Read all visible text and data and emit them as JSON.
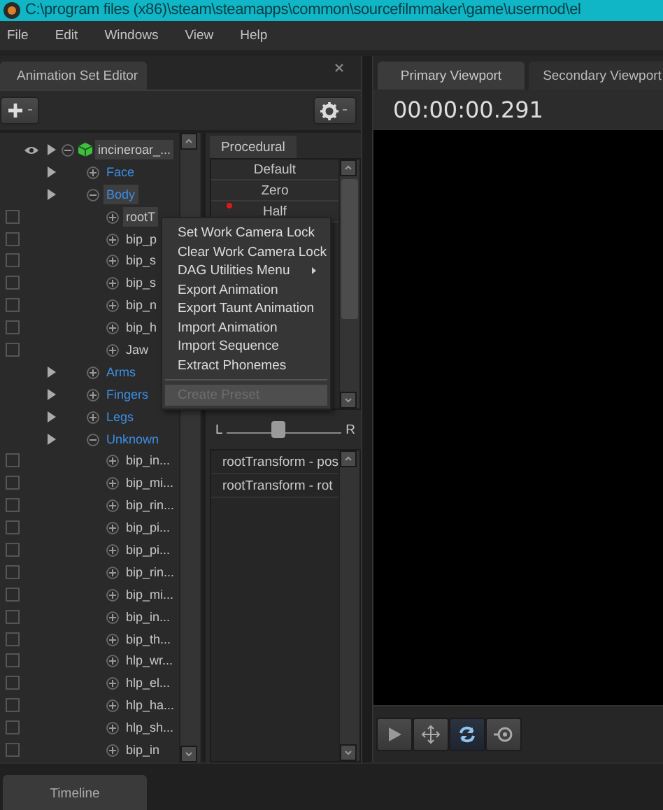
{
  "window": {
    "title": "C:\\program files (x86)\\steam\\steamapps\\common\\sourcefilmmaker\\game\\usermod\\el"
  },
  "menu_bar": [
    "File",
    "Edit",
    "Windows",
    "View",
    "Help"
  ],
  "animation_set_editor": {
    "tab": "Animation Set Editor",
    "tree": [
      {
        "label": "incineroar_...",
        "kind": "root",
        "visible": true,
        "expanded": true,
        "selected": true,
        "children": [
          {
            "label": "Face",
            "kind": "group",
            "expanded": false,
            "selected": false
          },
          {
            "label": "Body",
            "kind": "group",
            "expanded": true,
            "selected": true,
            "children": [
              {
                "label": "rootT",
                "kind": "control",
                "expanded": false,
                "selected": true,
                "checked": false
              },
              {
                "label": "bip_p",
                "kind": "control",
                "expanded": false,
                "selected": false,
                "checked": false
              },
              {
                "label": "bip_s",
                "kind": "control",
                "expanded": false,
                "selected": false,
                "checked": false
              },
              {
                "label": "bip_s",
                "kind": "control",
                "expanded": false,
                "selected": false,
                "checked": false
              },
              {
                "label": "bip_n",
                "kind": "control",
                "expanded": false,
                "selected": false,
                "checked": false
              },
              {
                "label": "bip_h",
                "kind": "control",
                "expanded": false,
                "selected": false,
                "checked": false
              },
              {
                "label": "Jaw",
                "kind": "control",
                "expanded": false,
                "selected": false,
                "checked": false
              }
            ]
          },
          {
            "label": "Arms",
            "kind": "group",
            "expanded": false,
            "selected": false
          },
          {
            "label": "Fingers",
            "kind": "group",
            "expanded": false,
            "selected": false
          },
          {
            "label": "Legs",
            "kind": "group",
            "expanded": false,
            "selected": false
          },
          {
            "label": "Unknown",
            "kind": "group",
            "expanded": true,
            "selected": false,
            "children": [
              {
                "label": "bip_in...",
                "kind": "control",
                "expanded": false,
                "selected": false,
                "checked": false
              },
              {
                "label": "bip_mi...",
                "kind": "control",
                "expanded": false,
                "selected": false,
                "checked": false
              },
              {
                "label": "bip_rin...",
                "kind": "control",
                "expanded": false,
                "selected": false,
                "checked": false
              },
              {
                "label": "bip_pi...",
                "kind": "control",
                "expanded": false,
                "selected": false,
                "checked": false
              },
              {
                "label": "bip_pi...",
                "kind": "control",
                "expanded": false,
                "selected": false,
                "checked": false
              },
              {
                "label": "bip_rin...",
                "kind": "control",
                "expanded": false,
                "selected": false,
                "checked": false
              },
              {
                "label": "bip_mi...",
                "kind": "control",
                "expanded": false,
                "selected": false,
                "checked": false
              },
              {
                "label": "bip_in...",
                "kind": "control",
                "expanded": false,
                "selected": false,
                "checked": false
              },
              {
                "label": "bip_th...",
                "kind": "control",
                "expanded": false,
                "selected": false,
                "checked": false
              },
              {
                "label": "hlp_wr...",
                "kind": "control",
                "expanded": false,
                "selected": false,
                "checked": false
              },
              {
                "label": "hlp_el...",
                "kind": "control",
                "expanded": false,
                "selected": false,
                "checked": false
              },
              {
                "label": "hlp_ha...",
                "kind": "control",
                "expanded": false,
                "selected": false,
                "checked": false
              },
              {
                "label": "hlp_sh...",
                "kind": "control",
                "expanded": false,
                "selected": false,
                "checked": false
              },
              {
                "label": "bip_in",
                "kind": "control",
                "expanded": false,
                "selected": false,
                "checked": false
              }
            ]
          }
        ]
      }
    ],
    "procedural_tab": "Procedural",
    "presets": [
      {
        "label": "Default",
        "marked": false
      },
      {
        "label": "Zero",
        "marked": false
      },
      {
        "label": "Half",
        "marked": true
      }
    ],
    "balance_slider": {
      "left": "L",
      "right": "R",
      "level": 0.45
    },
    "controls": [
      "rootTransform - pos",
      "rootTransform - rot"
    ]
  },
  "viewport": {
    "tabs": [
      {
        "label": "Primary Viewport",
        "selected": true
      },
      {
        "label": "Secondary Viewport",
        "selected": false
      }
    ],
    "time": "00:00:00.291",
    "tools": [
      {
        "kind": "select",
        "selected": false
      },
      {
        "kind": "move",
        "selected": false
      },
      {
        "kind": "rotate",
        "selected": true
      },
      {
        "kind": "scale",
        "selected": false
      }
    ]
  },
  "context_menu": {
    "items": [
      {
        "kind": "item",
        "label": "Set Work Camera Lock",
        "submenu": false,
        "disabled": false,
        "highlighted": false
      },
      {
        "kind": "item",
        "label": "Clear Work Camera Lock",
        "submenu": false,
        "disabled": false,
        "highlighted": false
      },
      {
        "kind": "item",
        "label": "DAG Utilities Menu",
        "submenu": true,
        "disabled": false,
        "highlighted": false
      },
      {
        "kind": "item",
        "label": "Export Animation",
        "submenu": false,
        "disabled": false,
        "highlighted": false
      },
      {
        "kind": "item",
        "label": "Export Taunt Animation",
        "submenu": false,
        "disabled": false,
        "highlighted": false
      },
      {
        "kind": "item",
        "label": "Import Animation",
        "submenu": false,
        "disabled": false,
        "highlighted": false
      },
      {
        "kind": "item",
        "label": "Import Sequence",
        "submenu": false,
        "disabled": false,
        "highlighted": false
      },
      {
        "kind": "item",
        "label": "Extract Phonemes",
        "submenu": false,
        "disabled": false,
        "highlighted": false
      },
      {
        "kind": "separator"
      },
      {
        "kind": "item",
        "label": "Create Preset",
        "submenu": false,
        "disabled": true,
        "highlighted": true
      }
    ]
  },
  "timeline": {
    "tab": "Timeline",
    "selected": true
  }
}
